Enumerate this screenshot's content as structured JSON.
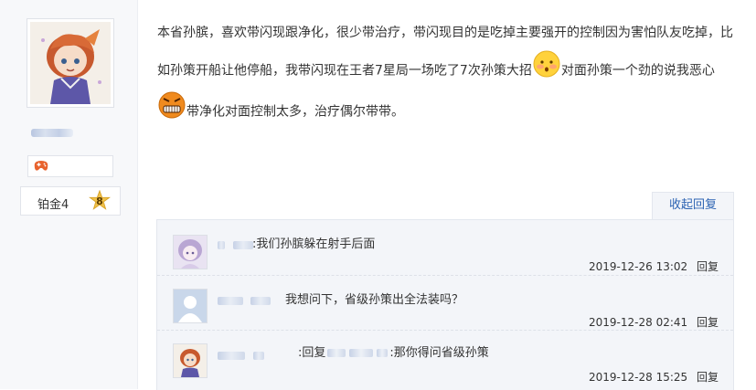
{
  "user": {
    "level_label": "铂金4",
    "level_number": "8",
    "avatar_icon": "anime-avatar",
    "badge_icon": "gamepad-icon"
  },
  "post": {
    "segments": [
      "本省孙膑，喜欢带闪现跟净化，很少带治疗，带闪现目的是吃掉主要强开的控制因为害怕队友吃掉，比如孙策开船让他停船，我带闪现在王者7星局一场吃了7次孙策大招",
      "对面孙策一个劲的说我恶心",
      "带净化对面控制太多，治疗偶尔带带。"
    ],
    "emoji_1": "shy-face-emoji",
    "emoji_2": "angry-face-emoji"
  },
  "replies": {
    "toggle_label": "收起回复",
    "items": [
      {
        "avatar_icon": "anime-girl-avatar",
        "text": ":我们孙膑躲在射手后面",
        "time": "2019-12-26 13:02",
        "reply_label": "回复"
      },
      {
        "avatar_icon": "default-user-avatar",
        "text": "我想问下，省级孙策出全法装吗？",
        "time": "2019-12-28 02:41",
        "reply_label": "回复"
      },
      {
        "avatar_icon": "anime-avatar",
        "prefix": ":回复",
        "text": ":那你得问省级孙策",
        "time": "2019-12-28 15:25",
        "reply_label": "回复"
      }
    ]
  },
  "colors": {
    "link": "#2d64b3",
    "panel_bg": "#f3f5f9",
    "sidebar_bg": "#f7f8fa"
  }
}
